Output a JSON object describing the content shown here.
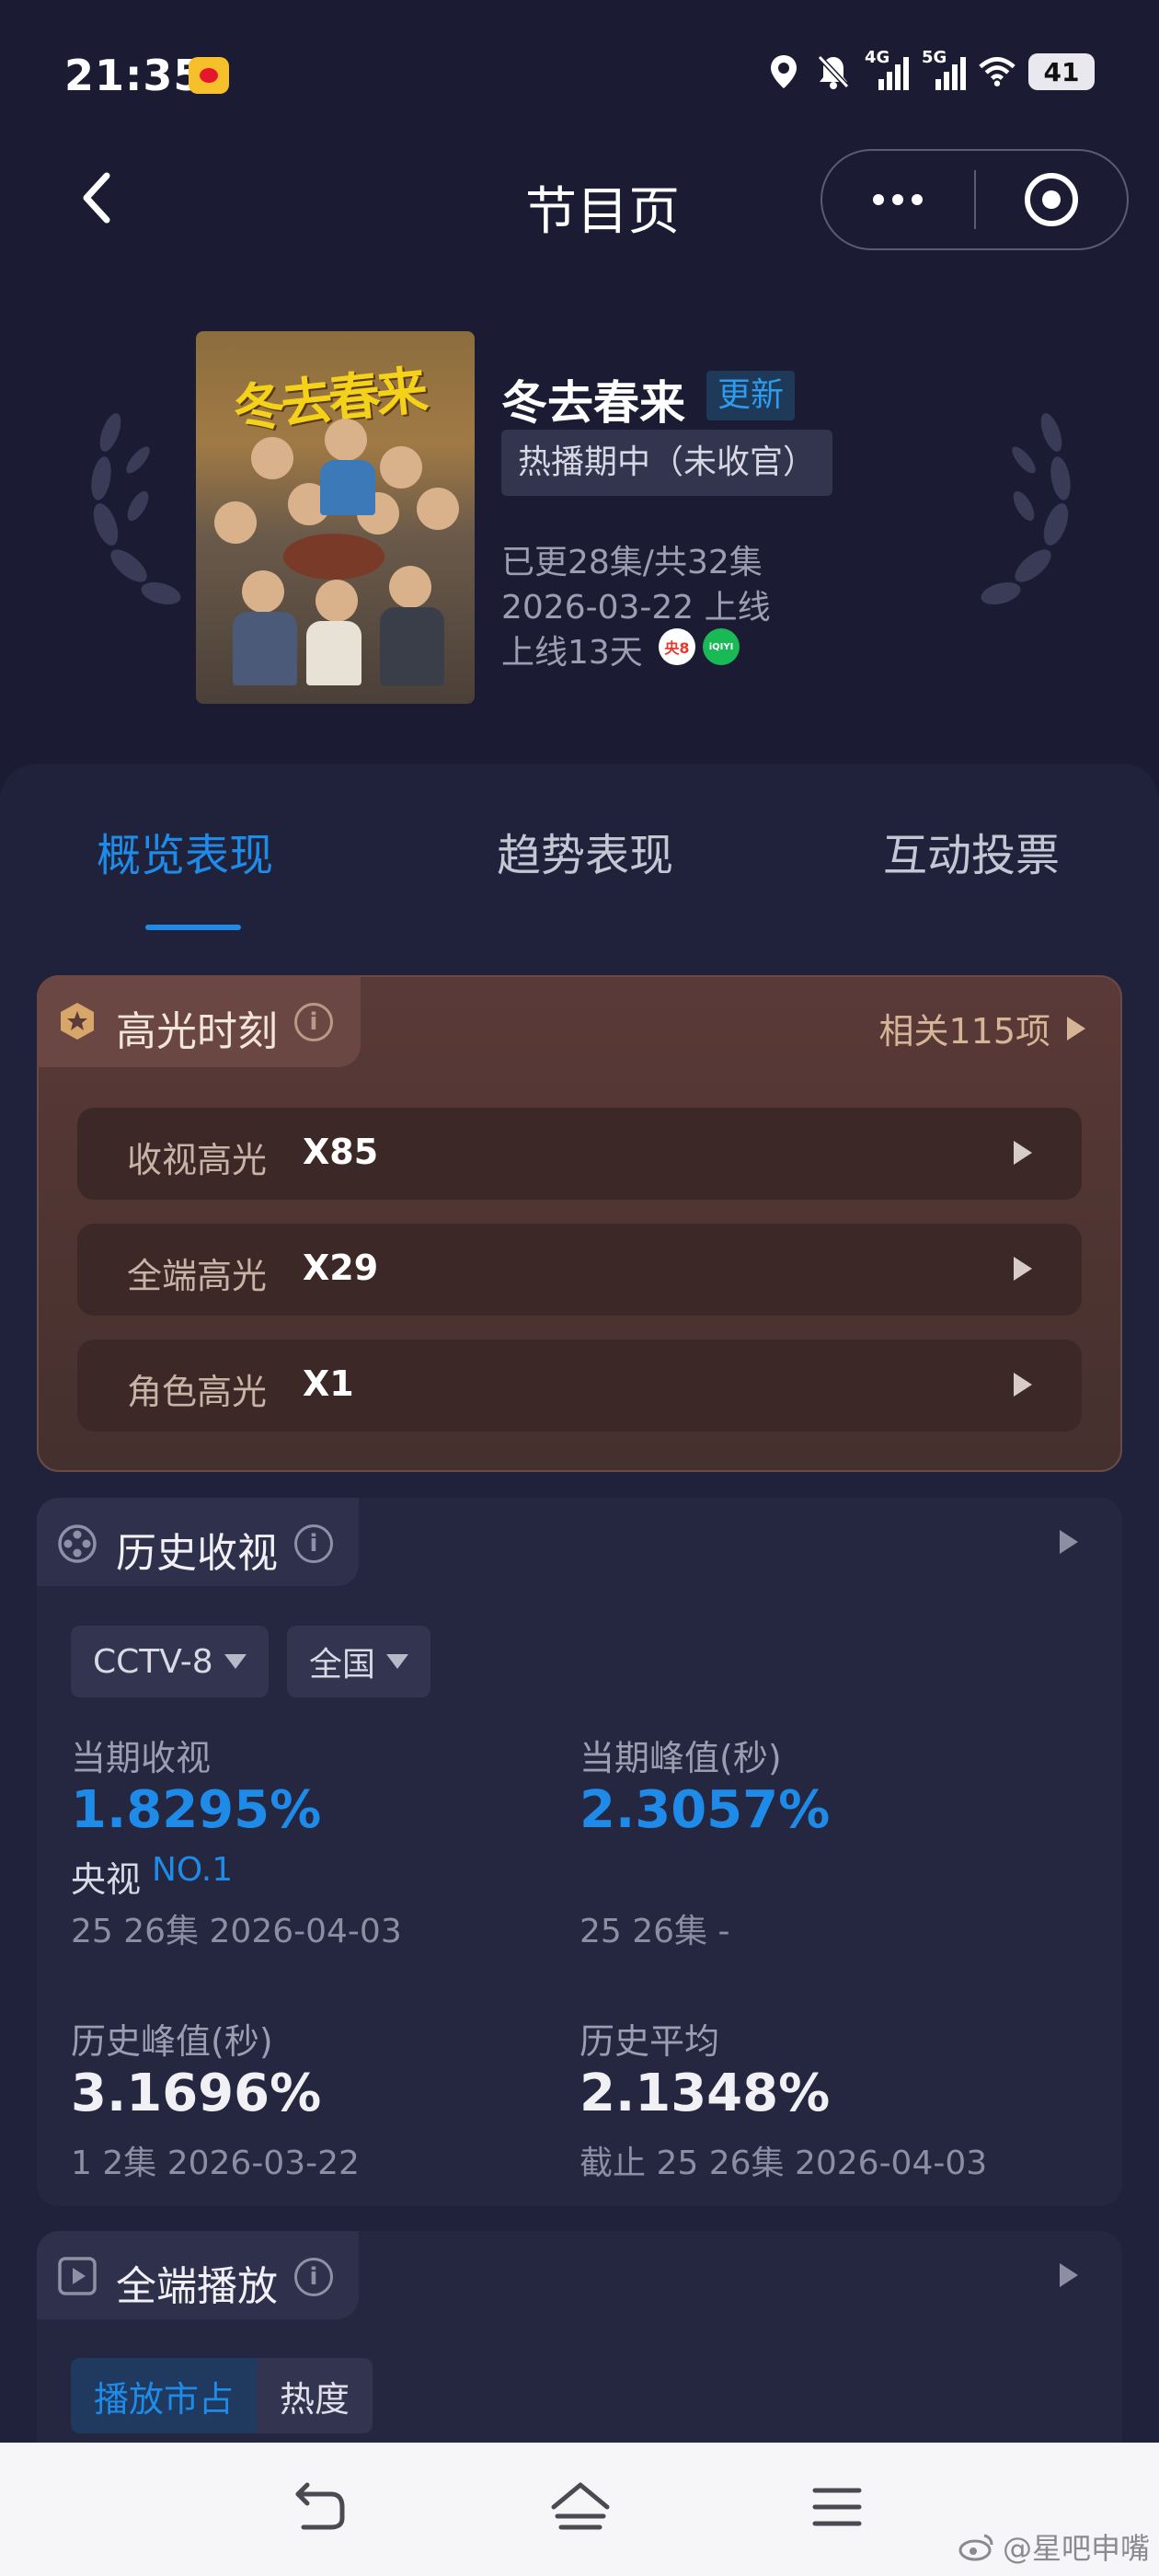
{
  "status_bar": {
    "time": "21:35",
    "battery": "41",
    "network_1": "4G",
    "network_2": "5G",
    "icons": [
      "weibo-icon",
      "location-icon",
      "bell-off-icon",
      "signal-icon",
      "wifi-icon",
      "battery-icon"
    ]
  },
  "nav": {
    "title": "节目页",
    "back_icon": "chevron-left-icon",
    "more_icon": "more-dots-icon",
    "target_icon": "target-icon"
  },
  "show": {
    "poster_art": "冬去春来",
    "title": "冬去春来",
    "update_badge": "更新",
    "status": "热播期中（未收官）",
    "episodes": "已更28集/共32集",
    "release": "2026-03-22 上线",
    "days": "上线13天",
    "channels": [
      {
        "name": "央8",
        "color": "#e63a2e"
      },
      {
        "name": "iQIYI",
        "color": "#19b955"
      }
    ]
  },
  "tabs": [
    {
      "label": "概览表现",
      "active": true
    },
    {
      "label": "趋势表现",
      "active": false
    },
    {
      "label": "互动投票",
      "active": false
    }
  ],
  "highlights": {
    "title": "高光时刻",
    "related": "相关115项",
    "rows": [
      {
        "label": "收视高光",
        "value": "X85"
      },
      {
        "label": "全端高光",
        "value": "X29"
      },
      {
        "label": "角色高光",
        "value": "X1"
      }
    ]
  },
  "history": {
    "title": "历史收视",
    "channel": "CCTV-8",
    "region": "全国",
    "current_rating_label": "当期收视",
    "current_rating": "1.8295%",
    "current_rank_prefix": "央视",
    "current_rank": "NO.1",
    "current_rating_note": "25 26集 2026-04-03",
    "current_peak_label": "当期峰值(秒)",
    "current_peak": "2.3057%",
    "current_peak_note": "25 26集 -",
    "hist_peak_label": "历史峰值(秒)",
    "hist_peak": "3.1696%",
    "hist_peak_note": "1 2集 2026-03-22",
    "hist_avg_label": "历史平均",
    "hist_avg": "2.1348%",
    "hist_avg_note": "截止 25 26集 2026-04-03"
  },
  "playback": {
    "title": "全端播放",
    "segments": [
      {
        "label": "播放市占",
        "active": true
      },
      {
        "label": "热度",
        "active": false
      }
    ]
  },
  "bottom_nav": {
    "icons": [
      "back-icon",
      "home-icon",
      "menu-icon"
    ]
  },
  "watermark": "@星吧申嘴"
}
